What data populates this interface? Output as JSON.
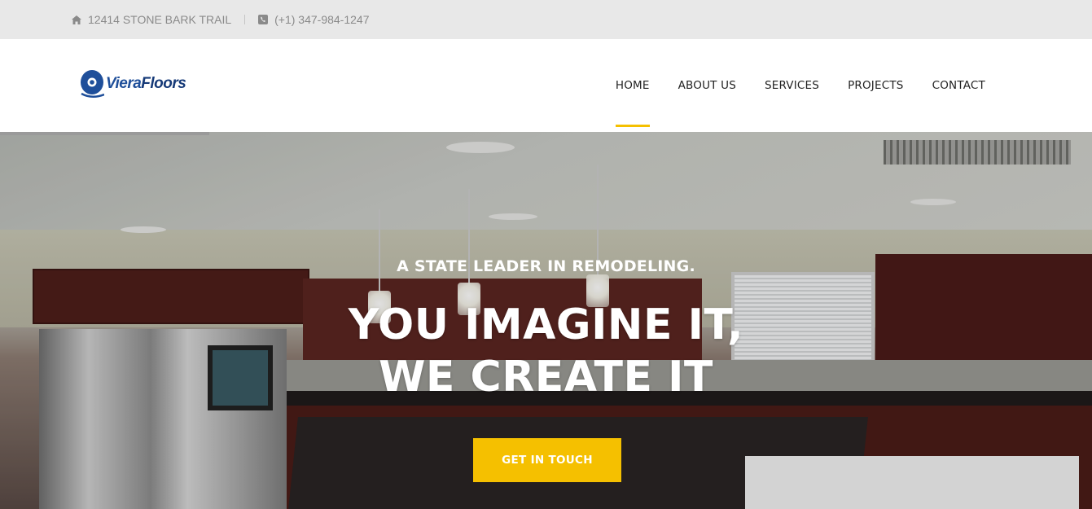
{
  "topbar": {
    "address": "12414 STONE BARK TRAIL",
    "phone": "(+1) 347-984-1247",
    "address_icon": "home-icon",
    "phone_icon": "phone-icon"
  },
  "logo": {
    "part1": "Viera",
    "part2": "Floors"
  },
  "nav": {
    "items": [
      {
        "label": "HOME",
        "active": true
      },
      {
        "label": "ABOUT US",
        "active": false
      },
      {
        "label": "SERVICES",
        "active": false
      },
      {
        "label": "PROJECTS",
        "active": false
      },
      {
        "label": "CONTACT",
        "active": false
      }
    ]
  },
  "hero": {
    "tagline": "A STATE LEADER IN REMODELING.",
    "headline_line1": "YOU IMAGINE IT,",
    "headline_line2": "WE CREATE IT",
    "cta_label": "GET IN TOUCH"
  },
  "colors": {
    "accent": "#f5c000",
    "topbar_bg": "#e8e8e8",
    "logo_blue": "#1f4f9a"
  }
}
